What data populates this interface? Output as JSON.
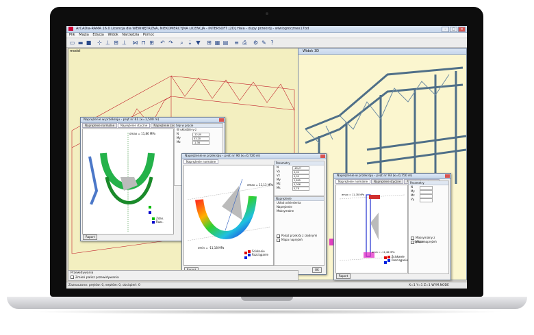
{
  "app": {
    "title": "ArCADia-RAMA 16.0 Licencja dla WEWNĘTRZNA, NIEKOMERCYJNA LICENCJA - INTERSOFT [2D] Hala - dupy przekrój - wiwiogrocznex17bd",
    "menu": [
      "Plik",
      "Mazja",
      "Edycja",
      "Widok",
      "Narzędzia",
      "Pomoc"
    ]
  },
  "left_view": {
    "label": "model"
  },
  "right_view": {
    "title": "Widok 3D"
  },
  "dialogs": [
    {
      "title": "Naprężenie w przekroju - pręt nr 61 (x=1,500 m)",
      "tabs": [
        "Naprężenie normalne",
        "Naprężenie styczne",
        "Naprężenie zastępcze"
      ],
      "side_header": "Siły w pręcie",
      "stress_label": "σmax = 11,86 MPa",
      "props": [
        {
          "label": "W układzie y-z",
          "value": ""
        },
        {
          "label": "N",
          "value": "-12,00"
        },
        {
          "label": "My",
          "value": "53,20"
        },
        {
          "label": "Mz",
          "value": "-1,38"
        }
      ],
      "legend": [
        "Zdan.",
        "Rozc."
      ],
      "report_button": "Raport"
    },
    {
      "title": "Naprężenie w przekroju - pręt nr 90 (x=0,720 m)",
      "tabs": [
        "Naprężenie normalne"
      ],
      "side_header": "Parametry",
      "side_header2": "Naprężenie",
      "stress_top": "σmax = 11,13 MPa",
      "stress_bottom": "σmin = -11,18 MPa",
      "props": [
        {
          "label": "N",
          "value": "-16,27"
        },
        {
          "label": "Vy",
          "value": "0,02"
        },
        {
          "label": "Vz",
          "value": "0,09"
        },
        {
          "label": "My",
          "value": "2,895"
        },
        {
          "label": "Mz",
          "value": "0,006"
        },
        {
          "label": "Ms",
          "value": "0,78"
        }
      ],
      "options": [
        "Układ odniesienia",
        "Naprężenie",
        "Maksymalne"
      ],
      "checks": [
        "Pokaż przekrój z rzędnymi",
        "Mapa naprężeń"
      ],
      "legend": [
        "Ściskanie",
        "Rozciąganie"
      ],
      "report_button": "Raport",
      "ok_button": "OK"
    },
    {
      "title": "Naprężenie w przekroju - pręt nr 93 (x=0,750 m)",
      "tabs": [
        "Naprężenie normalne",
        "Naprężenie styczne",
        "Naprężenie zastępcze"
      ],
      "side_header": "Parametry",
      "stress_top": "σmax = 11,78 MPa",
      "stress_bottom": "σmin = -11,48 MPa",
      "props": [
        {
          "label": "N",
          "value": ""
        },
        {
          "label": "My",
          "value": ""
        },
        {
          "label": "Mz",
          "value": ""
        },
        {
          "label": "Vy",
          "value": ""
        }
      ],
      "checks": [
        "Maksymalny z wyjątkiem",
        "Mapa naprężeń"
      ],
      "legend": [
        "Ściskanie",
        "Rozciąganie"
      ],
      "report_button": "Raport"
    }
  ],
  "bottom_panel": {
    "label": "Przewidywania",
    "checkbox": "Zmień palisz przewidywania"
  },
  "status": {
    "left": "Zaznaczono: prętów: 0, węzłów: 0, obciążeń: 0",
    "right": "X=1 Y=1 Z=1   WYM.NODE"
  }
}
